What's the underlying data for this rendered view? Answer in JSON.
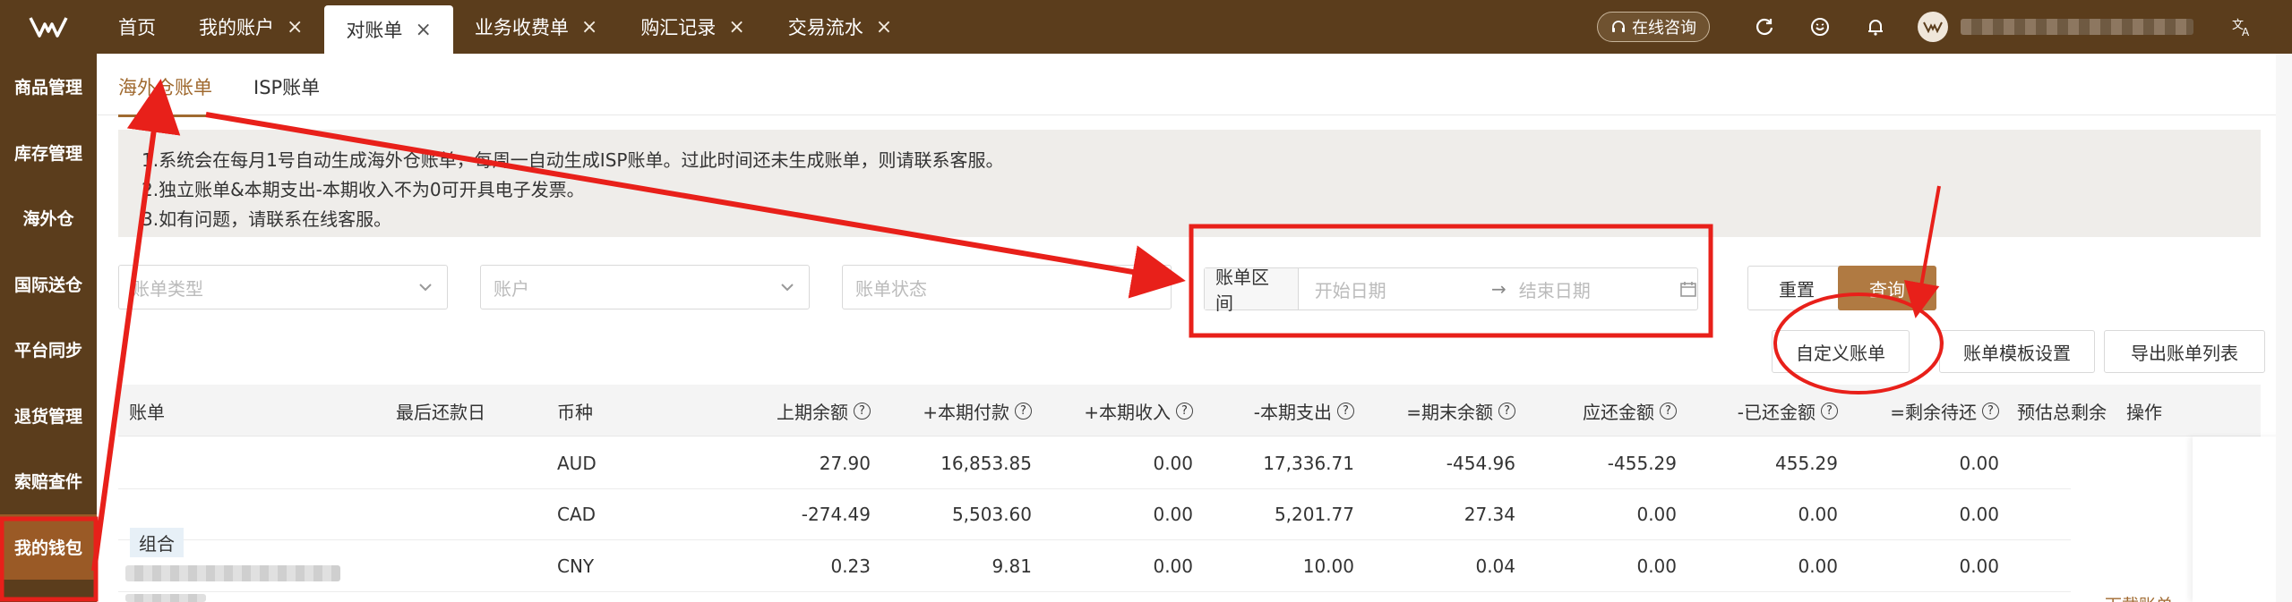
{
  "topbar": {
    "tabs": [
      {
        "label": "首页",
        "closable": false,
        "active": false
      },
      {
        "label": "我的账户",
        "closable": true,
        "active": false
      },
      {
        "label": "对账单",
        "closable": true,
        "active": true
      },
      {
        "label": "业务收费单",
        "closable": true,
        "active": false
      },
      {
        "label": "购汇记录",
        "closable": true,
        "active": false
      },
      {
        "label": "交易流水",
        "closable": true,
        "active": false
      }
    ],
    "consult_label": "在线咨询"
  },
  "sidebar": {
    "items": [
      {
        "label": "商品管理",
        "active": false
      },
      {
        "label": "库存管理",
        "active": false
      },
      {
        "label": "海外仓",
        "active": false
      },
      {
        "label": "国际送仓",
        "active": false
      },
      {
        "label": "平台同步",
        "active": false
      },
      {
        "label": "退货管理",
        "active": false
      },
      {
        "label": "索赔查件",
        "active": false
      },
      {
        "label": "我的钱包",
        "active": true
      }
    ]
  },
  "subtabs": [
    {
      "label": "海外仓账单",
      "active": true
    },
    {
      "label": "ISP账单",
      "active": false
    }
  ],
  "notice": {
    "lines": [
      "1.系统会在每月1号自动生成海外仓账单，每周一自动生成ISP账单。过此时间还未生成账单，则请联系客服。",
      "2.独立账单&本期支出-本期收入不为0可开具电子发票。",
      "3.如有问题，请联系在线客服。"
    ]
  },
  "filters": {
    "bill_type_placeholder": "账单类型",
    "account_placeholder": "账户",
    "bill_status_placeholder": "账单状态",
    "range_label": "账单区间",
    "start_placeholder": "开始日期",
    "end_placeholder": "结束日期",
    "reset_label": "重置",
    "query_label": "查询"
  },
  "actions": {
    "custom_bill_label": "自定义账单",
    "template_label": "账单模板设置",
    "export_label": "导出账单列表"
  },
  "table": {
    "columns": {
      "bill": "账单",
      "due_date": "最后还款日",
      "currency": "币种",
      "prev_balance": "上期余额",
      "payment": "+本期付款",
      "income": "+本期收入",
      "expense": "-本期支出",
      "end_balance": "=期末余额",
      "amount_due": "应还金额",
      "repaid": "-已还金额",
      "remaining": "=剩余待还",
      "estimated": "预估总剩余",
      "operation": "操作"
    },
    "rows": [
      {
        "currency": "AUD",
        "prev_balance": "27.90",
        "payment": "16,853.85",
        "income": "0.00",
        "expense": "17,336.71",
        "end_balance": "-454.96",
        "amount_due": "-455.29",
        "repaid": "455.29",
        "remaining": "0.00"
      },
      {
        "currency": "CAD",
        "prev_balance": "-274.49",
        "payment": "5,503.60",
        "income": "0.00",
        "expense": "5,201.77",
        "end_balance": "27.34",
        "amount_due": "0.00",
        "repaid": "0.00",
        "remaining": "0.00"
      },
      {
        "currency": "CNY",
        "prev_balance": "0.23",
        "payment": "9.81",
        "income": "0.00",
        "expense": "10.00",
        "end_balance": "0.04",
        "amount_due": "0.00",
        "repaid": "0.00",
        "remaining": "0.00"
      }
    ],
    "group_tag": "组合",
    "download_link": "下载账单"
  },
  "colors": {
    "brand_dark": "#5b3d1c",
    "accent": "#b07a42",
    "annotation_red": "#e8201a"
  }
}
